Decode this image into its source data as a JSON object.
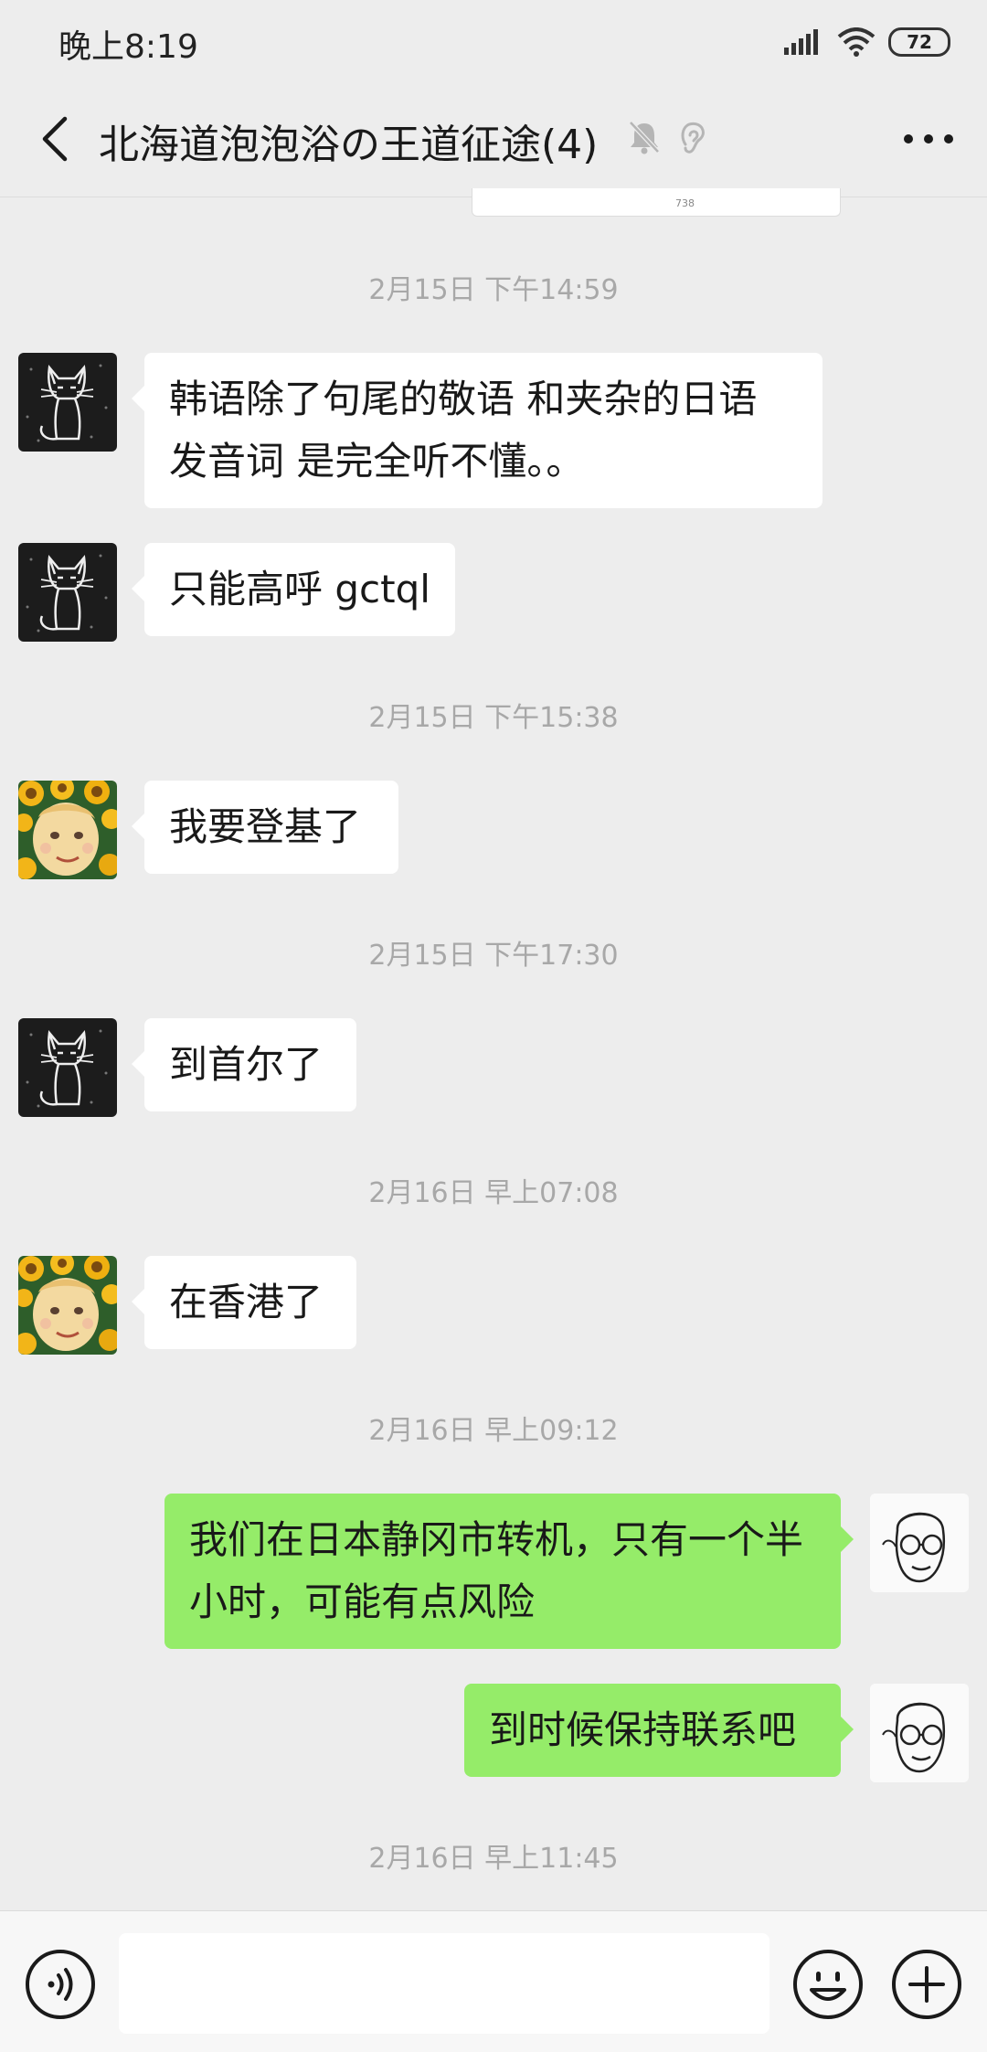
{
  "status_bar": {
    "time": "晚上8:19",
    "battery": "72"
  },
  "nav": {
    "title": "北海道泡泡浴の王道征途(4)"
  },
  "prev_card": {
    "caption": "738"
  },
  "messages": [
    {
      "type": "time",
      "text": "2月15日 下午14:59"
    },
    {
      "type": "msg",
      "side": "left",
      "avatar": "cat-avatar",
      "text": "韩语除了句尾的敬语 和夹杂的日语 发音词 是完全听不懂。。"
    },
    {
      "type": "msg",
      "side": "left",
      "avatar": "cat-avatar",
      "text": "只能高呼 gctql"
    },
    {
      "type": "time",
      "text": "2月15日 下午15:38"
    },
    {
      "type": "msg",
      "side": "left",
      "avatar": "sunflower-avatar",
      "text": "我要登基了"
    },
    {
      "type": "time",
      "text": "2月15日 下午17:30"
    },
    {
      "type": "msg",
      "side": "left",
      "avatar": "cat-avatar",
      "text": "到首尔了"
    },
    {
      "type": "time",
      "text": "2月16日 早上07:08"
    },
    {
      "type": "msg",
      "side": "left",
      "avatar": "sunflower-avatar",
      "text": "在香港了"
    },
    {
      "type": "time",
      "text": "2月16日 早上09:12"
    },
    {
      "type": "msg",
      "side": "right",
      "avatar": "sketch-face-avatar",
      "text": "我们在日本静冈市转机，只有一个半小时，可能有点风险"
    },
    {
      "type": "msg",
      "side": "right",
      "avatar": "sketch-face-avatar",
      "text": "到时候保持联系吧"
    },
    {
      "type": "time",
      "text": "2月16日 早上11:45"
    }
  ],
  "input": {
    "value": ""
  },
  "colors": {
    "background": "#ededed",
    "bubble_self": "#95ec69",
    "bubble_other": "#ffffff",
    "timestamp": "#a8a8a8"
  },
  "icons": [
    "back-arrow-icon",
    "mute-bell-icon",
    "ear-icon",
    "more-icon",
    "voice-icon",
    "emoji-icon",
    "plus-icon"
  ]
}
